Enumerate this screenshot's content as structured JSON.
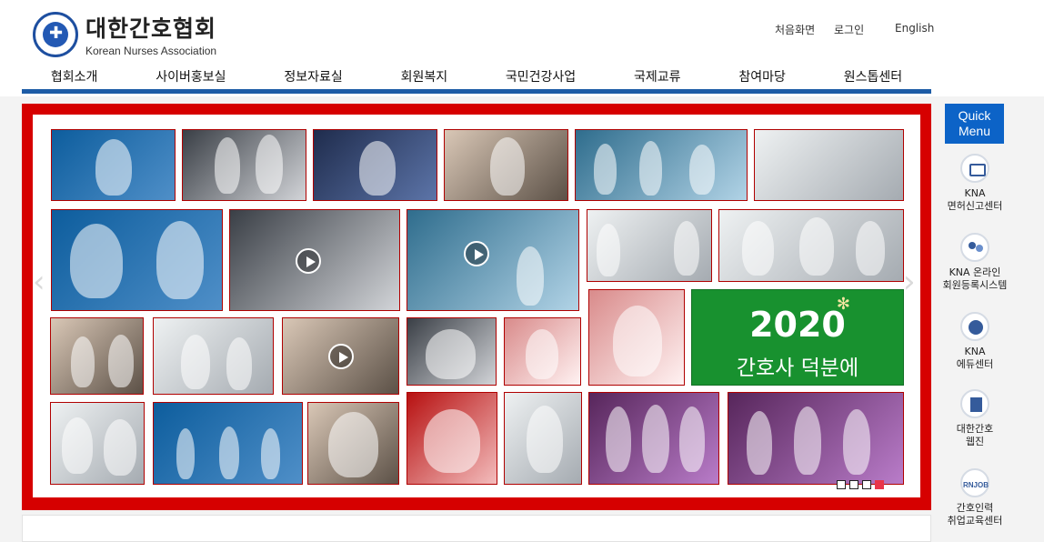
{
  "header": {
    "logo_korean": "대한간호협회",
    "logo_english": "Korean Nurses Association",
    "utility": [
      {
        "label": "처음화면"
      },
      {
        "label": "로그인"
      },
      {
        "label": "English"
      }
    ]
  },
  "nav": {
    "items": [
      "협회소개",
      "사이버홍보실",
      "정보자료실",
      "회원복지",
      "국민건강사업",
      "국제교류",
      "참여마당",
      "원스톱센터"
    ]
  },
  "gallery": {
    "feature_year": "2020",
    "feature_text": "간호사 덕분에",
    "slide_count": 4,
    "active_slide": 4
  },
  "quick_menu": {
    "title_line1": "Quick",
    "title_line2": "Menu",
    "items": [
      {
        "line1": "KNA",
        "line2": "면허신고센터",
        "icon": "license-card-icon"
      },
      {
        "line1": "KNA 온라인",
        "line2": "회원등록시스템",
        "icon": "member-registration-icon"
      },
      {
        "line1": "KNA",
        "line2": "에듀센터",
        "icon": "education-globe-icon"
      },
      {
        "line1": "대한간호",
        "line2": "웹진",
        "icon": "webzine-news-icon"
      },
      {
        "line1": "간호인력",
        "line2": "취업교육센터",
        "icon": "rnjob-icon"
      }
    ]
  }
}
